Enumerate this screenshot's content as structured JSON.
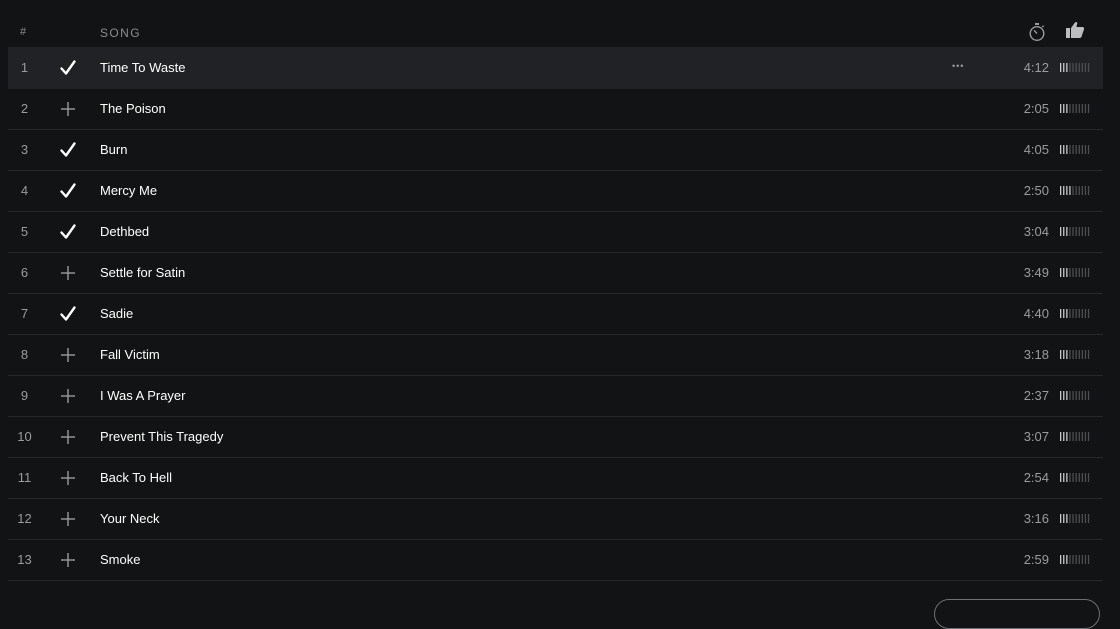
{
  "header": {
    "num_label": "#",
    "song_label": "SONG",
    "duration_icon": "stopwatch-icon",
    "popularity_icon": "thumbs-up-icon"
  },
  "colors": {
    "background": "#121314",
    "active_row": "#212225",
    "muted_text": "#9a9b9d",
    "text": "#ffffff"
  },
  "tracks": [
    {
      "num": "1",
      "title": "Time To Waste",
      "duration": "4:12",
      "saved": true,
      "active": true,
      "more": "•••",
      "popularity": 3
    },
    {
      "num": "2",
      "title": "The Poison",
      "duration": "2:05",
      "saved": false,
      "popularity": 3
    },
    {
      "num": "3",
      "title": "Burn",
      "duration": "4:05",
      "saved": true,
      "popularity": 3
    },
    {
      "num": "4",
      "title": "Mercy Me",
      "duration": "2:50",
      "saved": true,
      "popularity": 4
    },
    {
      "num": "5",
      "title": "Dethbed",
      "duration": "3:04",
      "saved": true,
      "popularity": 3
    },
    {
      "num": "6",
      "title": "Settle for Satin",
      "duration": "3:49",
      "saved": false,
      "popularity": 3
    },
    {
      "num": "7",
      "title": "Sadie",
      "duration": "4:40",
      "saved": true,
      "popularity": 3
    },
    {
      "num": "8",
      "title": "Fall Victim",
      "duration": "3:18",
      "saved": false,
      "popularity": 3
    },
    {
      "num": "9",
      "title": "I Was A Prayer",
      "duration": "2:37",
      "saved": false,
      "popularity": 3
    },
    {
      "num": "10",
      "title": "Prevent This Tragedy",
      "duration": "3:07",
      "saved": false,
      "popularity": 3
    },
    {
      "num": "11",
      "title": "Back To Hell",
      "duration": "2:54",
      "saved": false,
      "popularity": 3
    },
    {
      "num": "12",
      "title": "Your Neck",
      "duration": "3:16",
      "saved": false,
      "popularity": 3
    },
    {
      "num": "13",
      "title": "Smoke",
      "duration": "2:59",
      "saved": false,
      "popularity": 3
    }
  ],
  "popularity_max": 10
}
